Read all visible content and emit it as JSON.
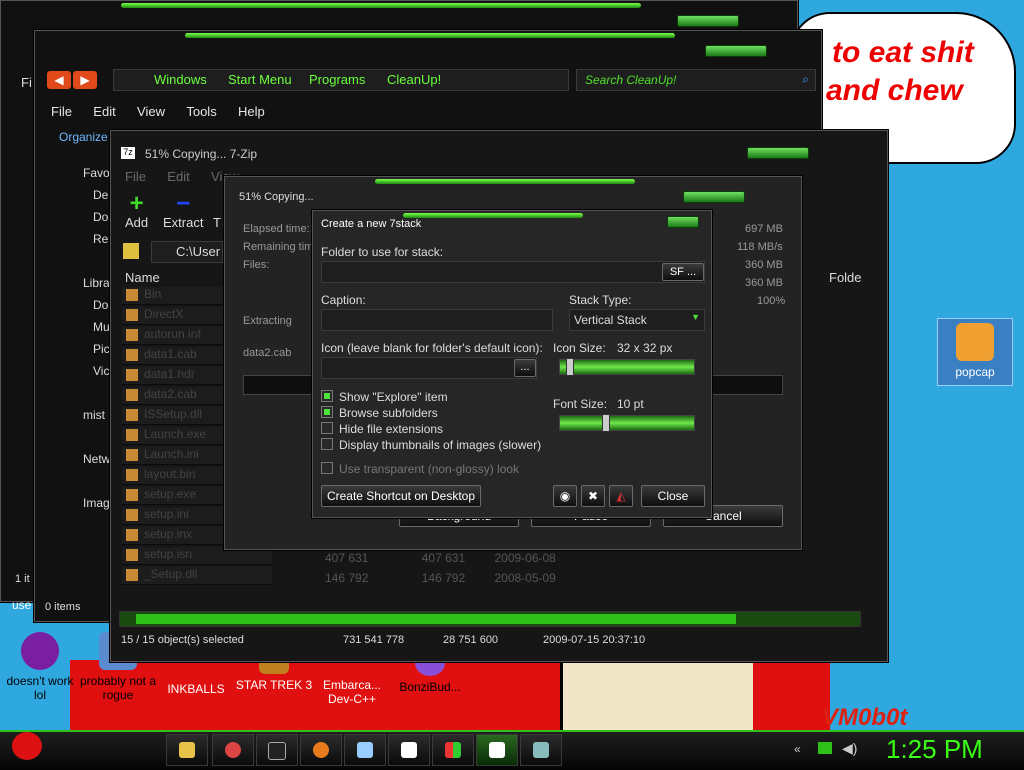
{
  "desktop": {
    "speech_bubble": {
      "line1": "to eat shit",
      "line2": "and chew"
    },
    "watermark": "VM0b0t",
    "icons": [
      {
        "label": "popcap"
      },
      {
        "label": "doesn't work lol"
      },
      {
        "label": "probably not a rogue"
      },
      {
        "label": "INKBALLS"
      },
      {
        "label": "STAR TREK 3"
      },
      {
        "label": "Embarca... Dev-C++"
      },
      {
        "label": "BonziBud..."
      }
    ]
  },
  "explorer_back": {
    "menu": [
      "Fi"
    ],
    "status": "1 it",
    "label_use": "use"
  },
  "explorer": {
    "address_items": [
      "Windows",
      "Start Menu",
      "Programs",
      "CleanUp!"
    ],
    "search_placeholder": "Search CleanUp!",
    "menu": [
      "File",
      "Edit",
      "View",
      "Tools",
      "Help"
    ],
    "organize": "Organize",
    "nav": [
      {
        "label": "Favo"
      },
      {
        "label": "De"
      },
      {
        "label": "Do"
      },
      {
        "label": "Re"
      },
      {
        "label": "Libra"
      },
      {
        "label": "Do"
      },
      {
        "label": "Mu"
      },
      {
        "label": "Pic"
      },
      {
        "label": "Vic"
      },
      {
        "label": "mist"
      },
      {
        "label": "Netw"
      },
      {
        "label": "Imag"
      }
    ],
    "status": "0 items"
  },
  "zip_window": {
    "title": "51% Copying... 7-Zip",
    "menu": [
      "File",
      "Edit",
      "View"
    ],
    "toolbar": {
      "add": "Add",
      "extract": "Extract",
      "test": "T"
    },
    "path": "C:\\User",
    "col_name": "Name",
    "col_folder": "Folde",
    "files": [
      "Bin",
      "DirectX",
      "autorun.inf",
      "data1.cab",
      "data1.hdr",
      "data2.cab",
      "ISSetup.dll",
      "Launch.exe",
      "Launch.ini",
      "layout.bin",
      "setup.exe",
      "setup.ini",
      "setup.inx",
      "setup.isn",
      "_Setup.dll"
    ],
    "rows_extra": [
      {
        "a": "407 631",
        "b": "407 631",
        "c": "2009-06-08"
      },
      {
        "a": "146 792",
        "b": "146 792",
        "c": "2008-05-09"
      }
    ],
    "status": {
      "selected": "15 / 15 object(s) selected",
      "size": "731 541 778",
      "packed": "28 751 600",
      "date": "2009-07-15 20:37:10"
    }
  },
  "copy_dialog": {
    "title": "51% Copying...",
    "labels": {
      "elapsed": "Elapsed time:",
      "remaining": "Remaining time:",
      "files": "Files:",
      "extracting": "Extracting",
      "file": "data2.cab"
    },
    "values": [
      "697 MB",
      "118 MB/s",
      "360 MB",
      "360 MB",
      "100%"
    ],
    "buttons": {
      "background": "Background",
      "pause": "Pause",
      "cancel": "Cancel"
    }
  },
  "stack_dialog": {
    "title": "Create a new 7stack",
    "folder_label": "Folder to use for stack:",
    "sf_button": "SF",
    "browse_button": "...",
    "caption_label": "Caption:",
    "stack_type_label": "Stack Type:",
    "stack_type_value": "Vertical Stack",
    "icon_label": "Icon (leave blank for folder's default icon):",
    "icon_browse": "...",
    "icon_size_label": "Icon Size:",
    "icon_size_value": "32 x 32 px",
    "icon_size_level": 0.05,
    "font_size_label": "Font Size:",
    "font_size_value": "10 pt",
    "font_size_level": 0.33,
    "options": [
      {
        "label": "Show \"Explore\" item",
        "checked": true
      },
      {
        "label": "Browse subfolders",
        "checked": true
      },
      {
        "label": "Hide file extensions",
        "checked": false
      },
      {
        "label": "Display thumbnails of images (slower)",
        "checked": false
      },
      {
        "label": "Use transparent (non-glossy) look",
        "checked": false,
        "disabled": true
      }
    ],
    "shortcut_button": "Create Shortcut on Desktop",
    "close_button": "Close"
  },
  "taskbar": {
    "clock": "1:25 PM",
    "accent": "#39ff14"
  }
}
